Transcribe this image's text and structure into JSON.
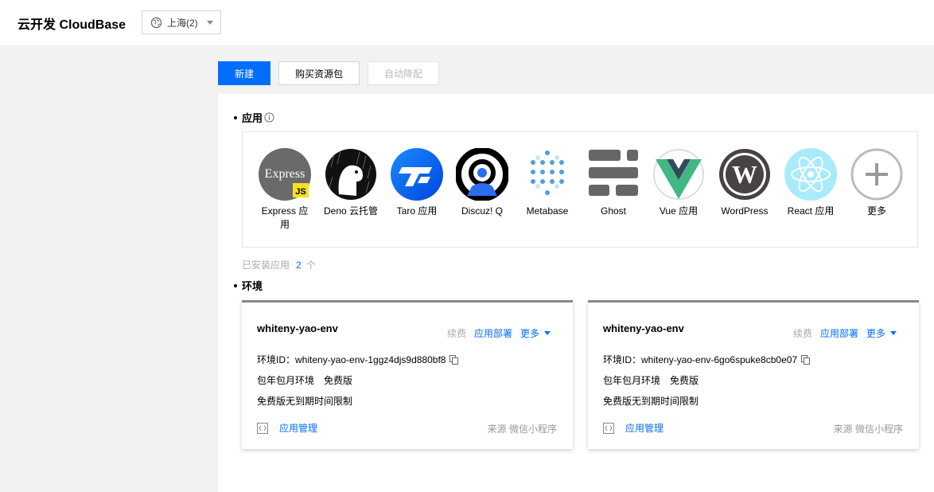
{
  "header": {
    "brand": "云开发 CloudBase",
    "region": "上海(2)"
  },
  "toolbar": {
    "new_label": "新建",
    "buy_label": "购买资源包",
    "auto_label": "自动降配"
  },
  "apps_section": {
    "title": "应用",
    "items": [
      {
        "name": "Express 应用",
        "icon": "express-icon"
      },
      {
        "name": "Deno 云托管",
        "icon": "deno-icon"
      },
      {
        "name": "Taro 应用",
        "icon": "taro-icon"
      },
      {
        "name": "Discuz! Q",
        "icon": "discuz-icon"
      },
      {
        "name": "Metabase",
        "icon": "metabase-icon"
      },
      {
        "name": "Ghost",
        "icon": "ghost-icon"
      },
      {
        "name": "Vue 应用",
        "icon": "vue-icon"
      },
      {
        "name": "WordPress",
        "icon": "wordpress-icon"
      },
      {
        "name": "React 应用",
        "icon": "react-icon"
      },
      {
        "name": "更多",
        "icon": "plus-icon"
      }
    ],
    "installed_label": "已安装应用",
    "installed_count": "2",
    "installed_unit": "个"
  },
  "env_section": {
    "title": "环境",
    "cards": [
      {
        "name": "whiteny-yao-env",
        "renew": "续费",
        "deploy": "应用部署",
        "more": "更多",
        "env_id": "环境ID：whiteny-yao-env-1ggz4djs9d880bf8",
        "plan": "包年包月环境　免费版",
        "note": "免费版无到期时间限制",
        "manage": "应用管理",
        "source": "来源 微信小程序"
      },
      {
        "name": "whiteny-yao-env",
        "renew": "续费",
        "deploy": "应用部署",
        "more": "更多",
        "env_id": "环境ID：whiteny-yao-env-6go6spuke8cb0e07",
        "plan": "包年包月环境　免费版",
        "note": "免费版无到期时间限制",
        "manage": "应用管理",
        "source": "来源 微信小程序"
      }
    ]
  },
  "colors": {
    "primary": "#006eff",
    "disabled_text": "#bbbbbb",
    "muted_text": "#999999"
  }
}
